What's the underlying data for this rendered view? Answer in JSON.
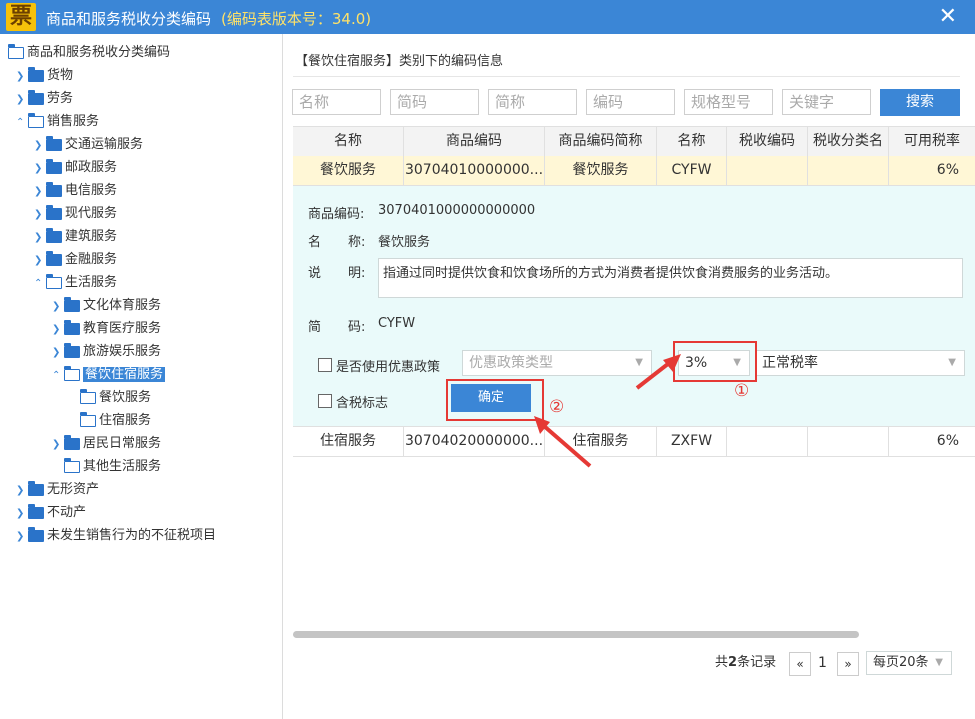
{
  "title": {
    "icon_glyph": "票",
    "text": "商品和服务税收分类编码",
    "version": "(编码表版本号：34.0)",
    "close": "✕"
  },
  "tree": {
    "root": "商品和服务税收分类编码",
    "items": [
      "货物",
      "劳务",
      "销售服务",
      "交通运输服务",
      "邮政服务",
      "电信服务",
      "现代服务",
      "建筑服务",
      "金融服务",
      "生活服务",
      "文化体育服务",
      "教育医疗服务",
      "旅游娱乐服务",
      "餐饮住宿服务",
      "餐饮服务",
      "住宿服务",
      "居民日常服务",
      "其他生活服务",
      "无形资产",
      "不动产",
      "未发生销售行为的不征税项目"
    ]
  },
  "main": {
    "section_title": "【餐饮住宿服务】类别下的编码信息",
    "search": {
      "placeholders": [
        "名称",
        "简码",
        "简称",
        "编码",
        "规格型号",
        "关键字"
      ],
      "button": "搜索"
    },
    "table": {
      "headers": [
        "名称",
        "商品编码",
        "商品编码简称",
        "名称",
        "税收编码",
        "税收分类名",
        "可用税率"
      ],
      "rows": [
        [
          "餐饮服务",
          "30704010000000...",
          "餐饮服务",
          "CYFW",
          "",
          "",
          "6%"
        ],
        [
          "住宿服务",
          "30704020000000...",
          "住宿服务",
          "ZXFW",
          "",
          "",
          "6%"
        ]
      ]
    },
    "detail": {
      "code_label": "商品编码:",
      "code_value": "3070401000000000000",
      "name_label_a": "名",
      "name_label_b": "称:",
      "name_value": "餐饮服务",
      "desc_label_a": "说",
      "desc_label_b": "明:",
      "desc_value": "指通过同时提供饮食和饮食场所的方式为消费者提供饮食消费服务的业务活动。",
      "abbr_label_a": "简",
      "abbr_label_b": "码:",
      "abbr_value": "CYFW",
      "preferential_checkbox": "是否使用优惠政策",
      "preferential_type_placeholder": "优惠政策类型",
      "tax_rate": "3%",
      "tax_rate_type": "正常税率",
      "tax_included_checkbox": "含税标志",
      "confirm_button": "确定"
    },
    "annotations": {
      "marker1": "①",
      "marker2": "②"
    },
    "pager": {
      "prefix": "共",
      "count": "2",
      "suffix": "条记录",
      "prev": "«",
      "page": "1",
      "next": "»",
      "per_page": "每页20条"
    }
  }
}
